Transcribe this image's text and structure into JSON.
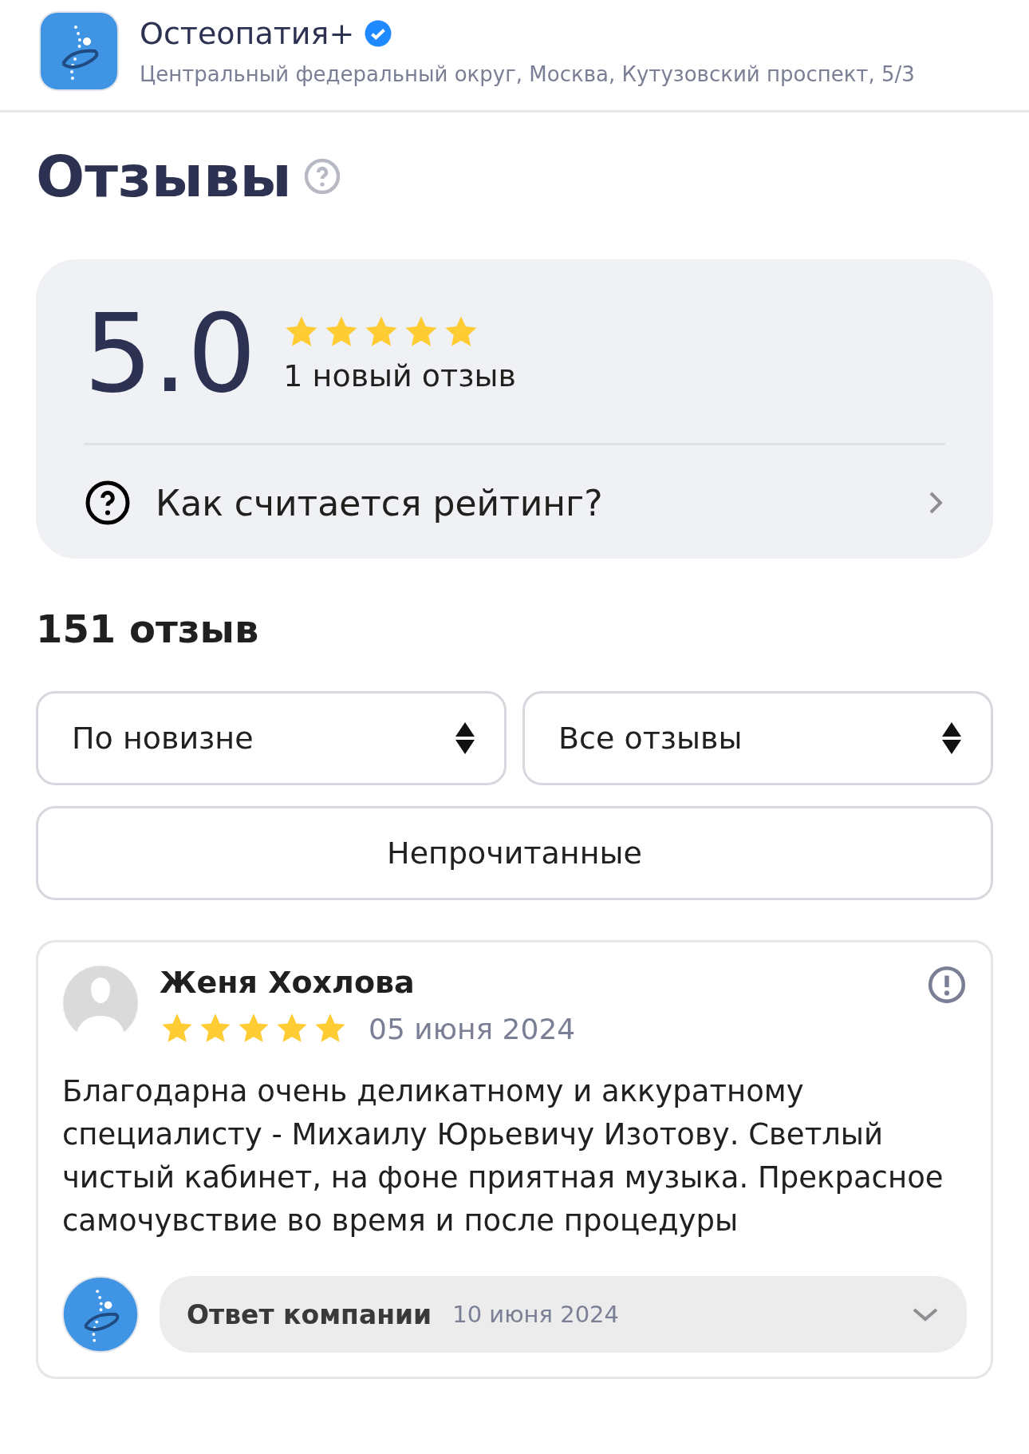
{
  "company": {
    "name": "Остеопатия+",
    "verified": true,
    "address": "Центральный федеральный округ, Москва, Кутузовский проспект, 5/3"
  },
  "heading": "Отзывы",
  "rating": {
    "value": "5.0",
    "stars": 5,
    "new_reviews": "1 новый отзыв",
    "how_link": "Как считается рейтинг?"
  },
  "count": "151 отзыв",
  "filters": [
    {
      "label": "По новизне"
    },
    {
      "label": "Все отзывы"
    }
  ],
  "unread_button": "Непрочитанные",
  "reviews": [
    {
      "author": "Женя Хохлова",
      "stars": 5,
      "date": "05 июня 2024",
      "text": "Благодарна очень деликатному и аккуратному специалисту - Михаилу Юрьевичу Изотову. Светлый чистый кабинет, на фоне приятная музыка. Прекрасное самочувствие во время и после процедуры",
      "reply": {
        "label": "Ответ компании",
        "date": "10 июня 2024",
        "expanded": false
      }
    }
  ]
}
